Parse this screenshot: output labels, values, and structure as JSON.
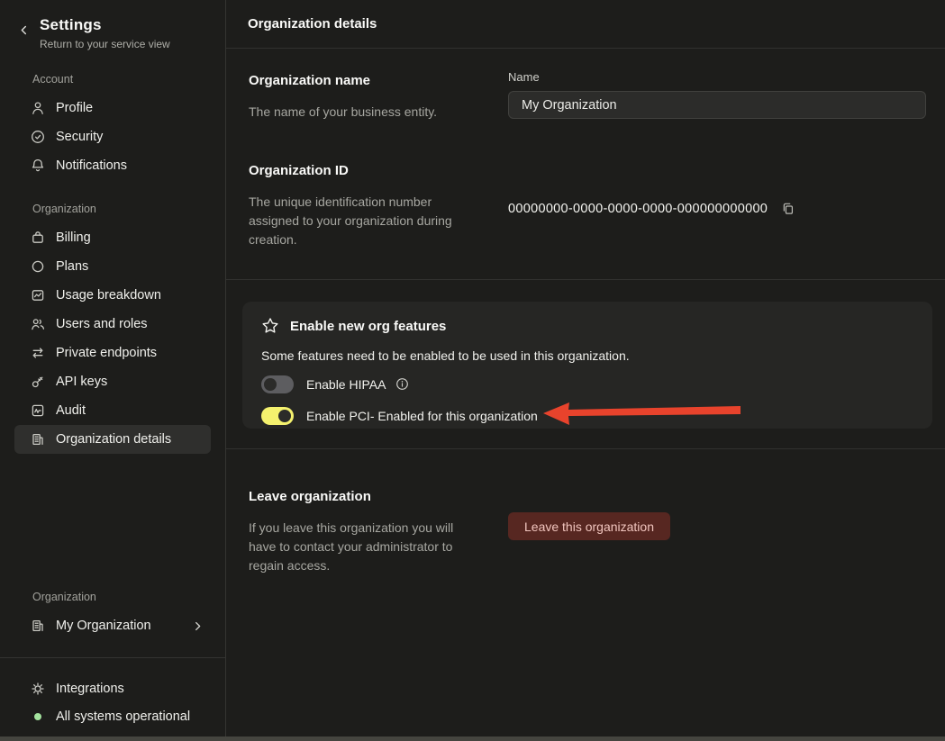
{
  "sidebar": {
    "title": "Settings",
    "subtitle": "Return to your service view",
    "account_label": "Account",
    "account_items": [
      {
        "label": "Profile",
        "icon": "user-icon"
      },
      {
        "label": "Security",
        "icon": "shield-check-icon"
      },
      {
        "label": "Notifications",
        "icon": "bell-icon"
      }
    ],
    "org_label": "Organization",
    "org_items": [
      {
        "label": "Billing",
        "icon": "billing-bag-icon"
      },
      {
        "label": "Plans",
        "icon": "circle-icon"
      },
      {
        "label": "Usage breakdown",
        "icon": "usage-chart-icon"
      },
      {
        "label": "Users and roles",
        "icon": "users-icon"
      },
      {
        "label": "Private endpoints",
        "icon": "swap-arrows-icon"
      },
      {
        "label": "API keys",
        "icon": "key-icon"
      },
      {
        "label": "Audit",
        "icon": "audit-pulse-icon"
      },
      {
        "label": "Organization details",
        "icon": "building-icon",
        "selected": true
      }
    ],
    "bottom_label": "Organization",
    "bottom_org": {
      "label": "My Organization",
      "icon": "building-icon"
    },
    "footer": {
      "integrations": "Integrations",
      "status": "All systems operational"
    }
  },
  "header": {
    "title": "Organization details"
  },
  "sections": {
    "name": {
      "heading": "Organization name",
      "description": "The name of your business entity.",
      "field_label": "Name",
      "field_value": "My Organization"
    },
    "org_id": {
      "heading": "Organization ID",
      "description": "The unique identification number assigned to your organization during creation.",
      "value": "00000000-0000-0000-0000-000000000000"
    },
    "features": {
      "heading": "Enable new org features",
      "description": "Some features need to be enabled to be used in this organization.",
      "toggles": [
        {
          "label": "Enable HIPAA",
          "enabled": false,
          "has_info": true
        },
        {
          "label": "Enable PCI- Enabled for this organization",
          "enabled": true
        }
      ]
    },
    "leave": {
      "heading": "Leave organization",
      "description": "If you leave this organization you will have to contact your administrator to regain access.",
      "button_label": "Leave this organization"
    }
  },
  "colors": {
    "toggle_on": "#f4f16e",
    "toggle_off": "#5d5d60",
    "arrow": "#e8432c",
    "danger_bg": "#572721",
    "danger_text": "#f2c6bf",
    "status_green": "#a4e39e"
  }
}
